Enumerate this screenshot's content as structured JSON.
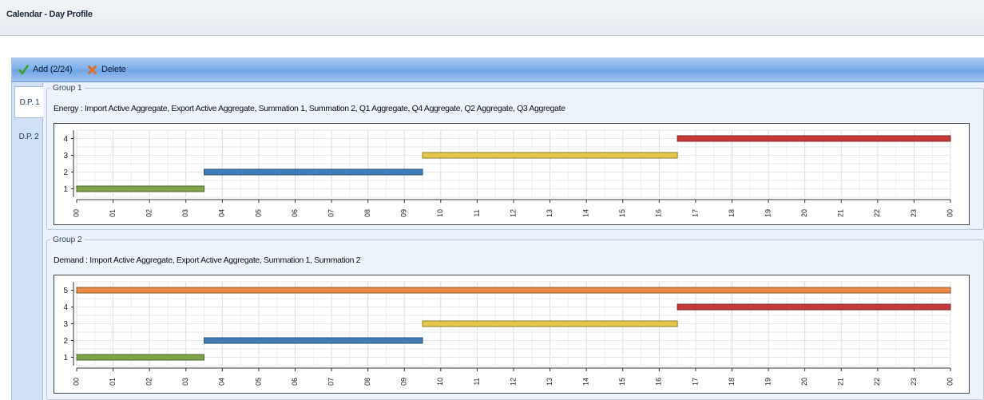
{
  "window": {
    "title": "Calendar - Day Profile"
  },
  "toolbar": {
    "add_label": "Add (2/24)",
    "delete_label": "Delete"
  },
  "icons": {
    "add": "checkmark-icon",
    "delete": "x-icon"
  },
  "colors": {
    "green": "#7ea34a",
    "blue": "#3f7fb8",
    "yellow": "#e6c84a",
    "red": "#c8383a",
    "orange": "#ea8a44",
    "toolbar": "#7fb1eb"
  },
  "tabs": [
    {
      "label": "D.P. 1",
      "active": true
    },
    {
      "label": "D.P. 2",
      "active": false
    }
  ],
  "groups": [
    {
      "label": "Group 1",
      "description": "Energy : Import Active Aggregate, Export Active Aggregate, Summation 1, Summation 2, Q1 Aggregate, Q4 Aggregate, Q2 Aggregate, Q3 Aggregate"
    },
    {
      "label": "Group 2",
      "description": "Demand : Import Active Aggregate, Export Active Aggregate, Summation 1, Summation 2"
    }
  ],
  "chart_data": [
    {
      "type": "bar",
      "orientation": "horizontal-gantt",
      "x_ticks": [
        "00",
        "01",
        "02",
        "03",
        "04",
        "05",
        "06",
        "07",
        "08",
        "09",
        "10",
        "11",
        "12",
        "13",
        "14",
        "15",
        "16",
        "17",
        "18",
        "19",
        "20",
        "21",
        "22",
        "23",
        "00"
      ],
      "y_ticks": [
        "1",
        "2",
        "3",
        "4"
      ],
      "xlim": [
        0,
        24
      ],
      "ylim": [
        0.5,
        4.5
      ],
      "grid": true,
      "bars": [
        {
          "level": 1,
          "start": 0,
          "end": 3.5,
          "color": "green"
        },
        {
          "level": 2,
          "start": 3.5,
          "end": 9.5,
          "color": "blue"
        },
        {
          "level": 3,
          "start": 9.5,
          "end": 16.5,
          "color": "yellow"
        },
        {
          "level": 4,
          "start": 16.5,
          "end": 24,
          "color": "red"
        }
      ]
    },
    {
      "type": "bar",
      "orientation": "horizontal-gantt",
      "x_ticks": [
        "00",
        "01",
        "02",
        "03",
        "04",
        "05",
        "06",
        "07",
        "08",
        "09",
        "10",
        "11",
        "12",
        "13",
        "14",
        "15",
        "16",
        "17",
        "18",
        "19",
        "20",
        "21",
        "22",
        "23",
        "00"
      ],
      "y_ticks": [
        "1",
        "2",
        "3",
        "4",
        "5"
      ],
      "xlim": [
        0,
        24
      ],
      "ylim": [
        0.5,
        5.5
      ],
      "grid": true,
      "bars": [
        {
          "level": 5,
          "start": 0,
          "end": 24,
          "color": "orange"
        },
        {
          "level": 4,
          "start": 16.5,
          "end": 24,
          "color": "red"
        },
        {
          "level": 3,
          "start": 9.5,
          "end": 16.5,
          "color": "yellow"
        },
        {
          "level": 2,
          "start": 3.5,
          "end": 9.5,
          "color": "blue"
        },
        {
          "level": 1,
          "start": 0,
          "end": 3.5,
          "color": "green"
        }
      ]
    }
  ]
}
